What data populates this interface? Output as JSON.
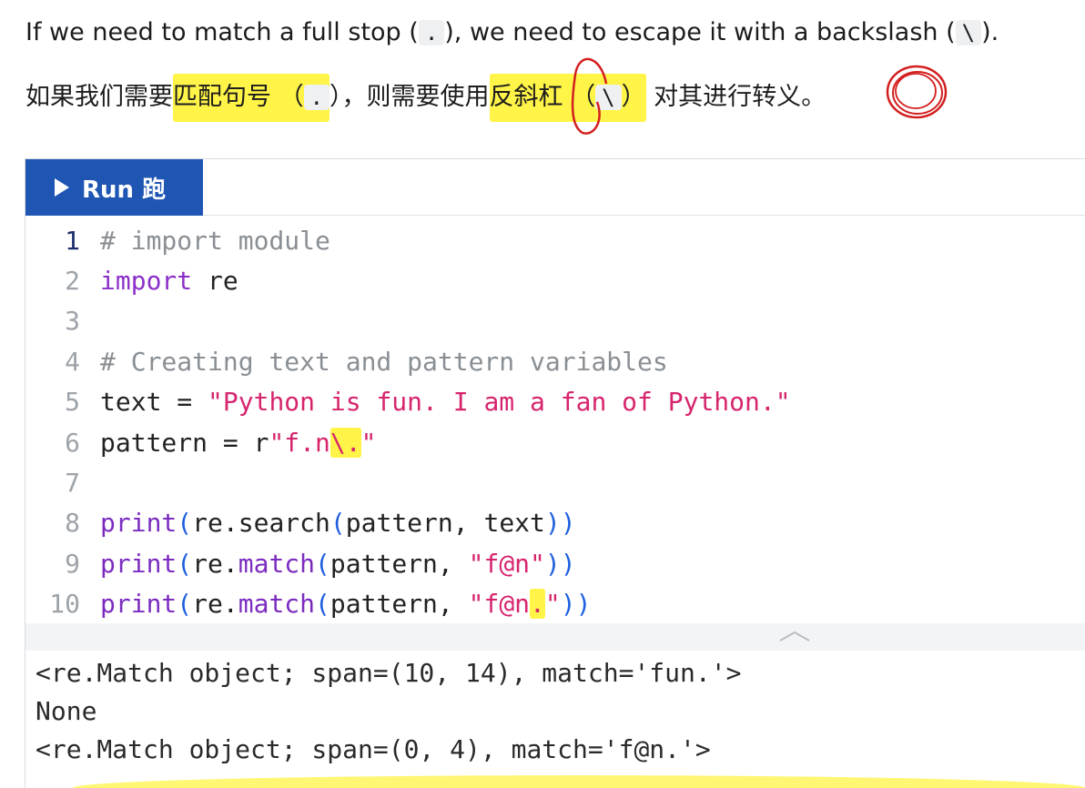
{
  "intro": {
    "en_part1": "If we need to match a full stop (",
    "en_dot": ".",
    "en_part2": "), we need to escape it with a backslash (",
    "en_backslash": "\\",
    "en_part3": ").",
    "zh_part1": "如果我们需要",
    "zh_highlight1": "匹配句号 （",
    "zh_dot": ".",
    "zh_part2": "），则需要使用",
    "zh_highlight2": "反斜杠 （",
    "zh_backslash": "\\",
    "zh_highlight2_end": "）",
    "zh_part3": " 对其进行",
    "zh_highlight3": "转义",
    "zh_part4": "。"
  },
  "toolbar": {
    "run_label": "Run 跑"
  },
  "colors": {
    "run_button": "#1f56b4",
    "highlight": "#fff000",
    "annotation": "#d31f1f"
  },
  "code": {
    "lines": [
      {
        "num": "1",
        "tokens": [
          {
            "t": "# import module",
            "c": "c-com"
          }
        ]
      },
      {
        "num": "2",
        "tokens": [
          {
            "t": "import",
            "c": "c-kw"
          },
          {
            "t": " re",
            "c": "c-def"
          }
        ]
      },
      {
        "num": "3",
        "tokens": []
      },
      {
        "num": "4",
        "tokens": [
          {
            "t": "# Creating text and pattern variables",
            "c": "c-com"
          }
        ]
      },
      {
        "num": "5",
        "tokens": [
          {
            "t": "text",
            "c": "c-def"
          },
          {
            "t": " = ",
            "c": "c-def"
          },
          {
            "t": "\"Python is fun. I am a fan of Python.\"",
            "c": "c-str"
          }
        ]
      },
      {
        "num": "6",
        "tokens": [
          {
            "t": "pattern",
            "c": "c-def"
          },
          {
            "t": " = ",
            "c": "c-def"
          },
          {
            "t": "r",
            "c": "c-def"
          },
          {
            "t": "\"f.n",
            "c": "c-str"
          },
          {
            "t": "\\.",
            "c": "c-str hl"
          },
          {
            "t": "\"",
            "c": "c-str"
          }
        ]
      },
      {
        "num": "7",
        "tokens": []
      },
      {
        "num": "8",
        "tokens": [
          {
            "t": "print",
            "c": "c-fn"
          },
          {
            "t": "(",
            "c": "c-par"
          },
          {
            "t": "re",
            "c": "c-def"
          },
          {
            "t": ".",
            "c": "c-def"
          },
          {
            "t": "search",
            "c": "c-def"
          },
          {
            "t": "(",
            "c": "c-par"
          },
          {
            "t": "pattern, text",
            "c": "c-def"
          },
          {
            "t": "))",
            "c": "c-par"
          }
        ]
      },
      {
        "num": "9",
        "tokens": [
          {
            "t": "print",
            "c": "c-fn"
          },
          {
            "t": "(",
            "c": "c-par"
          },
          {
            "t": "re",
            "c": "c-def"
          },
          {
            "t": ".",
            "c": "c-def"
          },
          {
            "t": "match",
            "c": "c-attr"
          },
          {
            "t": "(",
            "c": "c-par"
          },
          {
            "t": "pattern, ",
            "c": "c-def"
          },
          {
            "t": "\"f@n\"",
            "c": "c-str"
          },
          {
            "t": "))",
            "c": "c-par"
          }
        ]
      },
      {
        "num": "10",
        "tokens": [
          {
            "t": "print",
            "c": "c-fn"
          },
          {
            "t": "(",
            "c": "c-par"
          },
          {
            "t": "re",
            "c": "c-def"
          },
          {
            "t": ".",
            "c": "c-def"
          },
          {
            "t": "match",
            "c": "c-attr"
          },
          {
            "t": "(",
            "c": "c-par"
          },
          {
            "t": "pattern, ",
            "c": "c-def"
          },
          {
            "t": "\"f@n",
            "c": "c-str"
          },
          {
            "t": ".",
            "c": "c-str hl"
          },
          {
            "t": "\"",
            "c": "c-str"
          },
          {
            "t": "))",
            "c": "c-par"
          }
        ]
      }
    ]
  },
  "output": {
    "lines": [
      "<re.Match object; span=(10, 14), match='fun.'>",
      "None",
      "<re.Match object; span=(0, 4), match='f@n.'>"
    ]
  },
  "icons": {
    "run": "play-icon",
    "collapse": "chevron-up-icon"
  }
}
